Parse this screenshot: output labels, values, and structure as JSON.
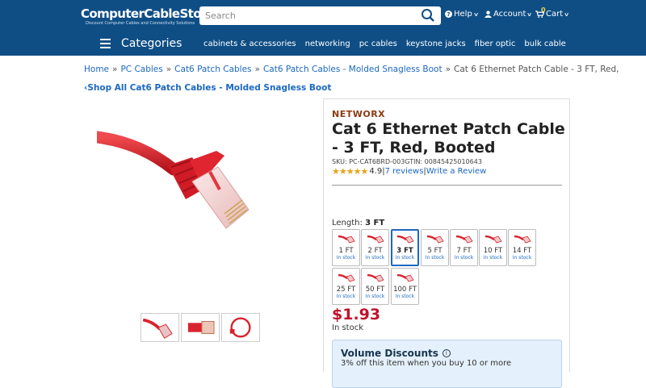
{
  "header": {
    "logo_text": "ComputerCableStore",
    "logo_tagline": "Discount Computer Cables and Connectivity Solutions",
    "search_placeholder": "Search",
    "help_label": "Help",
    "account_label": "Account",
    "cart_label": "Cart",
    "cart_count": "0",
    "categories_label": "Categories",
    "nav": [
      "cabinets & accessories",
      "networking",
      "pc cables",
      "keystone jacks",
      "fiber optic",
      "bulk cable"
    ]
  },
  "breadcrumb": [
    "Home",
    "PC Cables",
    "Cat6 Patch Cables",
    "Cat6 Patch Cables - Molded Snagless Boot"
  ],
  "breadcrumb_current": "Cat 6 Ethernet Patch Cable - 3 FT, Red,",
  "shop_all": "‹Shop All Cat6 Patch Cables - Molded Snagless Boot",
  "product": {
    "brand": "NETWORX",
    "title": "Cat 6 Ethernet Patch Cable - 3 FT, Red, Booted",
    "sku_line": "SKU: PC-CAT6BRD-003GTIN: 00845425010643",
    "rating": "4.9",
    "stars": "★★★★★",
    "reviews_link": "7 reviews",
    "write_review": "Write a Review",
    "length_label": "Length:",
    "length_value": "3 FT",
    "options": [
      {
        "label": "1 FT",
        "status": "In stock"
      },
      {
        "label": "2 FT",
        "status": "In stock"
      },
      {
        "label": "3 FT",
        "status": "In stock"
      },
      {
        "label": "5 FT",
        "status": "In stock"
      },
      {
        "label": "7 FT",
        "status": "In stock"
      },
      {
        "label": "10 FT",
        "status": "In stock"
      },
      {
        "label": "14 FT",
        "status": "In stock"
      },
      {
        "label": "25 FT",
        "status": "In stock"
      },
      {
        "label": "50 FT",
        "status": "In stock"
      },
      {
        "label": "100 FT",
        "status": "In stock"
      }
    ],
    "price": "$1.93",
    "stock": "In stock",
    "volume_title": "Volume Discounts",
    "volume_line": "3% off this item when you buy 10 or more"
  },
  "colors": {
    "header_bg": "#0f4e85",
    "link": "#1b68c2",
    "price": "#c0122b",
    "brand": "#8b3b12",
    "cable": "#d9232e"
  }
}
